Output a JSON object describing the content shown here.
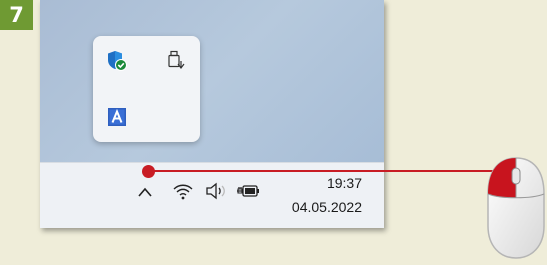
{
  "step": {
    "number": "7"
  },
  "colors": {
    "badge": "#6f9a33",
    "pointer_line": "#c81c24",
    "desktop": "#b0c3da",
    "taskbar": "#eef1f5"
  },
  "flyout": {
    "icons": [
      {
        "name": "windows-security-shield-icon"
      },
      {
        "name": "usb-safely-remove-icon"
      },
      {
        "name": "app-a-icon",
        "letter": "A"
      }
    ]
  },
  "taskbar": {
    "icons": [
      {
        "name": "show-hidden-icons-chevron-icon"
      },
      {
        "name": "wifi-icon"
      },
      {
        "name": "speaker-icon"
      },
      {
        "name": "battery-plugged-icon"
      }
    ],
    "time": "19:37",
    "date": "04.05.2022"
  },
  "callout": {
    "target": "show-hidden-icons-chevron-icon",
    "device": "mouse-left-click-icon"
  }
}
